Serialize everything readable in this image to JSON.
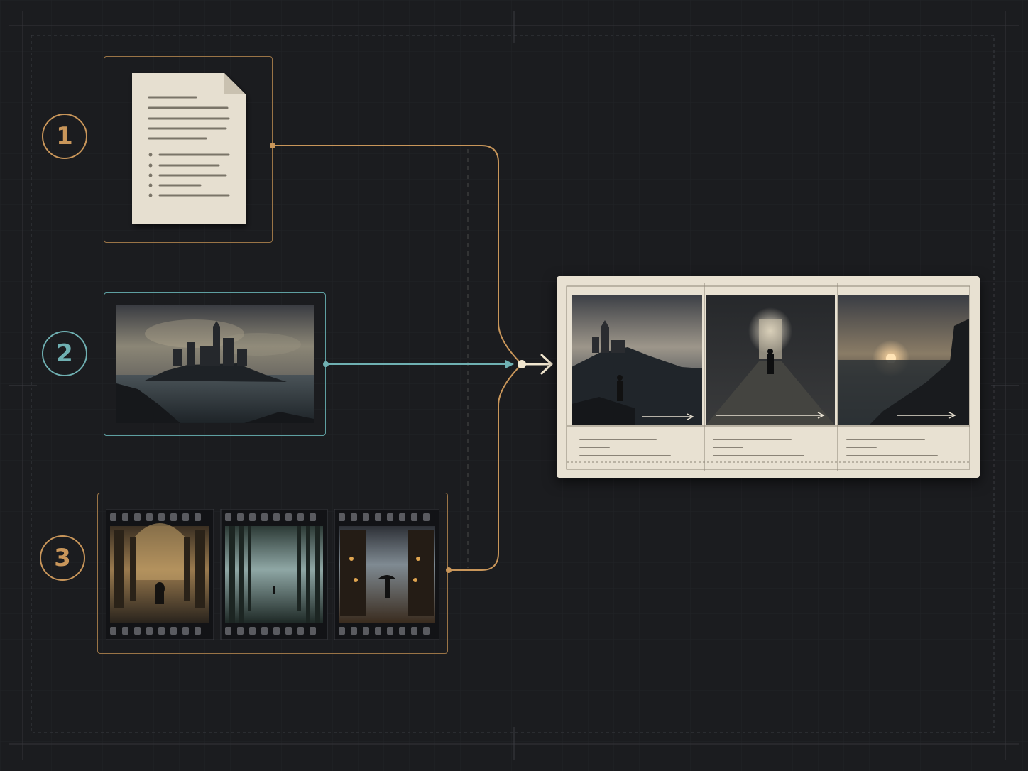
{
  "steps": [
    {
      "number": "1",
      "input": "document",
      "icon": "document-icon",
      "color": "#c9965a"
    },
    {
      "number": "2",
      "input": "reference-image",
      "icon": "castle-image",
      "color": "#6fb0b2"
    },
    {
      "number": "3",
      "input": "film-strip",
      "icon": "film-strip-icon",
      "color": "#c9965a"
    }
  ],
  "film_frames": [
    {
      "scene": "cathedral-hall"
    },
    {
      "scene": "forest-path"
    },
    {
      "scene": "rainy-street"
    }
  ],
  "output": {
    "icon": "storyboard-icon",
    "panels": [
      {
        "scene": "castle-coast"
      },
      {
        "scene": "stone-corridor"
      },
      {
        "scene": "sunset-sea"
      }
    ]
  },
  "colors": {
    "background": "#1b1c1f",
    "amber": "#c9965a",
    "teal": "#6fb0b2",
    "paper": "#e8e1d2",
    "arrow": "#f1e6cf"
  }
}
